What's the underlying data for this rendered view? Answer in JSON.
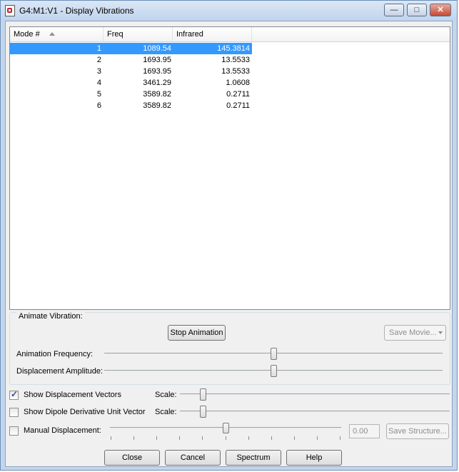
{
  "window": {
    "title": "G4:M1:V1 - Display Vibrations",
    "icon": "app-icon"
  },
  "list": {
    "columns": [
      "Mode #",
      "Freq",
      "Infrared"
    ],
    "rows": [
      {
        "mode": "1",
        "freq": "1089.54",
        "ir": "145.3814",
        "selected": true
      },
      {
        "mode": "2",
        "freq": "1693.95",
        "ir": "13.5533"
      },
      {
        "mode": "3",
        "freq": "1693.95",
        "ir": "13.5533"
      },
      {
        "mode": "4",
        "freq": "3461.29",
        "ir": "1.0608"
      },
      {
        "mode": "5",
        "freq": "3589.82",
        "ir": "0.2711"
      },
      {
        "mode": "6",
        "freq": "3589.82",
        "ir": "0.2711"
      }
    ]
  },
  "animate": {
    "group_label": "Animate Vibration:",
    "stop_button": "Stop Animation",
    "save_movie": "Save Movie...",
    "frequency_label": "Animation Frequency:",
    "amplitude_label": "Displacement Amplitude:",
    "frequency_level": 0.5,
    "amplitude_level": 0.5
  },
  "options": {
    "show_vectors_label": "Show Displacement Vectors",
    "show_vectors_checked": true,
    "show_dipole_label": "Show Dipole Derivative Unit Vector",
    "show_dipole_checked": false,
    "scale_label": "Scale:",
    "manual_label": "Manual Displacement:",
    "manual_checked": false,
    "manual_value": "0.00",
    "save_structure": "Save Structure..."
  },
  "buttons": {
    "close": "Close",
    "cancel": "Cancel",
    "spectrum": "Spectrum",
    "help": "Help"
  },
  "colors": {
    "selection": "#3399ff",
    "check": "#2d4f8e"
  }
}
